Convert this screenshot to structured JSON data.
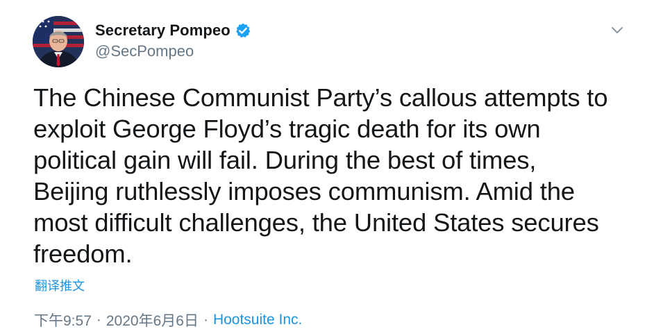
{
  "tweet": {
    "author": {
      "display_name": "Secretary Pompeo",
      "handle": "@SecPompeo",
      "verified": true
    },
    "text": "The Chinese Communist Party’s callous attempts to\nexploit George Floyd’s tragic death for its own\npolitical gain will fail. During the best of times,\nBeijing ruthlessly imposes communism. Amid the\nmost difficult challenges, the United States secures\nfreedom.",
    "translate_label": "翻译推文",
    "time": "下午9:57",
    "separator": "·",
    "date": "2020年6月6日",
    "source": "Hootsuite Inc."
  },
  "icons": {
    "verified": "verified-badge-icon",
    "menu": "chevron-down-icon"
  },
  "colors": {
    "text": "#14171a",
    "secondary": "#657786",
    "link": "#1b95e0",
    "verified": "#1da1f2"
  }
}
